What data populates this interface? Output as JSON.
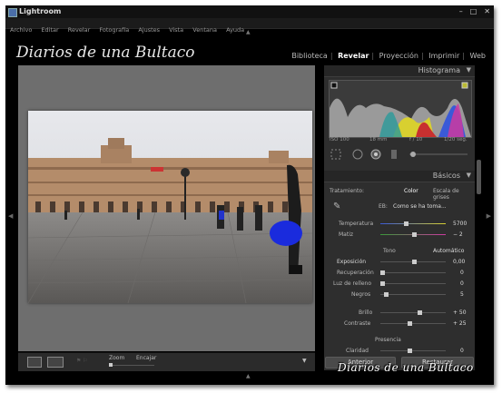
{
  "window": {
    "title": "Lightroom"
  },
  "menu": [
    "Archivo",
    "Editar",
    "Revelar",
    "Fotografía",
    "Ajustes",
    "Vista",
    "Ventana",
    "Ayuda"
  ],
  "identity_plate": "Diarios de una Bultaco",
  "modules": [
    "Biblioteca",
    "Revelar",
    "Proyección",
    "Imprimir",
    "Web"
  ],
  "active_module": "Revelar",
  "histogram": {
    "header": "Histograma",
    "iso": "ISO 100",
    "focal": "18 mm",
    "aperture": "f / 10",
    "shutter": "1/20 seg."
  },
  "basic": {
    "header": "Básicos",
    "treatment_label": "Tratamiento:",
    "treatment_color": "Color",
    "treatment_bw": "Escala de grises",
    "wb_label": "EB:",
    "wb_value": "Como se ha toma...",
    "temperature": {
      "label": "Temperatura",
      "value": "5700"
    },
    "tint": {
      "label": "Matiz",
      "value": "− 2"
    },
    "tone_label": "Tono",
    "auto_label": "Automático",
    "exposure": {
      "label": "Exposición",
      "value": "0,00"
    },
    "recovery": {
      "label": "Recuperación",
      "value": "0"
    },
    "fill_light": {
      "label": "Luz de relleno",
      "value": "0"
    },
    "blacks": {
      "label": "Negros",
      "value": "5"
    },
    "brightness": {
      "label": "Brillo",
      "value": "+ 50"
    },
    "contrast": {
      "label": "Contraste",
      "value": "+ 25"
    },
    "presence_label": "Presencia",
    "clarity": {
      "label": "Claridad",
      "value": "0"
    }
  },
  "toolbar": {
    "zoom_label": "Zoom",
    "fit_label": "Encajar"
  },
  "buttons": {
    "prev": "Anterior",
    "reset": "Restaurar"
  },
  "watermark": "Diarios de una Bultaco"
}
